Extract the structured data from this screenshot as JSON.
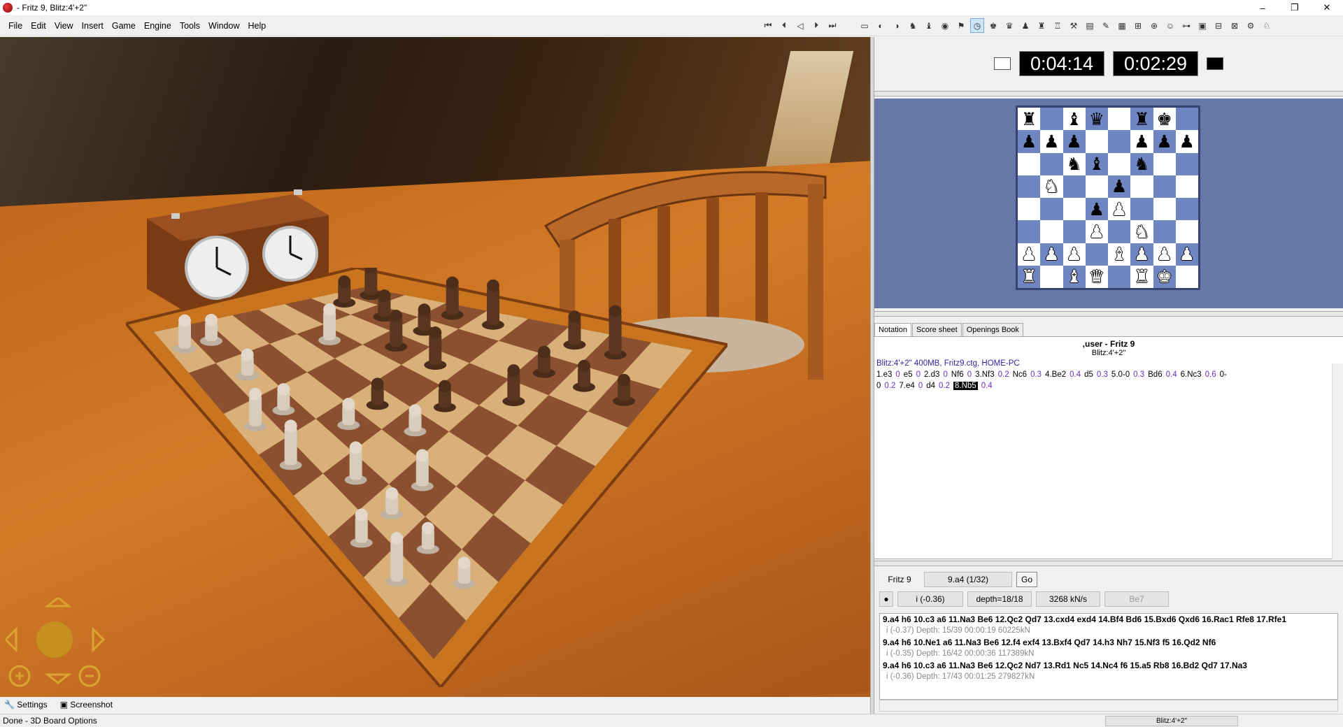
{
  "window": {
    "title": " - Fritz 9, Blitz:4'+2\"",
    "minimize": "–",
    "maximize": "❐",
    "close": "✕"
  },
  "menu": [
    "File",
    "Edit",
    "View",
    "Insert",
    "Game",
    "Engine",
    "Tools",
    "Window",
    "Help"
  ],
  "toolbar": {
    "nav_icons": [
      "first-move-icon",
      "prev-move-icon",
      "take-back-icon",
      "next-move-icon",
      "last-move-icon"
    ],
    "nav_glyphs": [
      "⏮",
      "⏴",
      "◁",
      "⏵",
      "⏭"
    ],
    "tool_icons": [
      "new-game-icon",
      "engine-icon",
      "hint-icon",
      "analysis-icon",
      "piece-icon",
      "globe-icon",
      "flag-icon",
      "clock-icon",
      "king-icon",
      "piece-red-icon",
      "pawn-icon",
      "trophy-icon",
      "fritz-icon",
      "tools-icon",
      "book-icon",
      "pen-icon",
      "board-icon",
      "table-icon",
      "database-icon",
      "people-icon",
      "link-icon",
      "save-icon",
      "layout-icon",
      "grid-icon",
      "gear-icon",
      "piece-set-icon"
    ],
    "tool_glyphs": [
      "▭",
      "◐",
      "◑",
      "♞",
      "♝",
      "◉",
      "⚑",
      "◷",
      "♚",
      "♛",
      "♟",
      "♜",
      "♖",
      "⚒",
      "▤",
      "✎",
      "▦",
      "⊞",
      "⊕",
      "☺",
      "⊶",
      "▣",
      "⊟",
      "⊠",
      "⚙",
      "♘"
    ]
  },
  "clock": {
    "white_time": "0:04:14",
    "black_time": "0:02:29",
    "white_color": "#ffffff",
    "black_color": "#000000"
  },
  "mini_board": {
    "rows": [
      [
        "r",
        "",
        "b",
        "q",
        "",
        "r",
        "k",
        ""
      ],
      [
        "p",
        "p",
        "p",
        "",
        "",
        "p",
        "p",
        "p"
      ],
      [
        "",
        "",
        "n",
        "b",
        "",
        "n",
        "",
        ""
      ],
      [
        "",
        "N",
        "",
        "",
        "p",
        "",
        "",
        ""
      ],
      [
        "",
        "",
        "",
        "p",
        "P",
        "",
        "",
        ""
      ],
      [
        "",
        "",
        "",
        "P",
        "",
        "N",
        "",
        ""
      ],
      [
        "P",
        "P",
        "P",
        "",
        "B",
        "P",
        "P",
        "P"
      ],
      [
        "R",
        "",
        "B",
        "Q",
        "",
        "R",
        "K",
        ""
      ]
    ]
  },
  "tabs": [
    "Notation",
    "Score sheet",
    "Openings Book"
  ],
  "notation": {
    "players": ",user - Fritz 9",
    "event": "Blitz:4'+2\"",
    "info": "Blitz:4'+2\"  400MB, Fritz9.ctg, HOME-PC",
    "moves": [
      {
        "m": "1.e3",
        "e": "0"
      },
      {
        "m": "e5",
        "e": "0"
      },
      {
        "m": "2.d3",
        "e": "0"
      },
      {
        "m": "Nf6",
        "e": "0"
      },
      {
        "m": "3.Nf3",
        "e": "0.2"
      },
      {
        "m": "Nc6",
        "e": "0.3"
      },
      {
        "m": "4.Be2",
        "e": "0.4"
      },
      {
        "m": "d5",
        "e": "0.3"
      },
      {
        "m": "5.0-0",
        "e": "0.3"
      },
      {
        "m": "Bd6",
        "e": "0.4"
      },
      {
        "m": "6.Nc3",
        "e": "0.6"
      },
      {
        "m": "0-0",
        "e": "0.2"
      },
      {
        "m": "7.e4",
        "e": "0"
      },
      {
        "m": "d4",
        "e": "0.2"
      },
      {
        "m": "8.Nb5",
        "e": "0.4",
        "current": true
      }
    ]
  },
  "engine": {
    "name": "Fritz 9",
    "current_move": "9.a4 (1/32)",
    "go": "Go",
    "eval": "i  (-0.36)",
    "depth": "depth=18/18",
    "speed": "3268 kN/s",
    "best": "Be7",
    "lines": [
      {
        "pv": "9.a4 h6 10.c3 a6 11.Na3 Be6 12.Qc2 Qd7 13.cxd4 exd4 14.Bf4 Bd6 15.Bxd6 Qxd6 16.Rac1 Rfe8 17.Rfe1",
        "info": "i  (-0.37)  Depth: 15/39  00:00:19  60225kN"
      },
      {
        "pv": "9.a4 h6 10.Ne1 a6 11.Na3 Be6 12.f4 exf4 13.Bxf4 Qd7 14.h3 Nh7 15.Nf3 f5 16.Qd2 Nf6",
        "info": "i  (-0.35)  Depth: 16/42  00:00:36  117389kN"
      },
      {
        "pv": "9.a4 h6 10.c3 a6 11.Na3 Be6 12.Qc2 Nd7 13.Rd1 Nc5 14.Nc4 f6 15.a5 Rb8 16.Bd2 Qd7 17.Na3",
        "info": "i  (-0.36)  Depth: 17/43  00:01:25  279827kN"
      }
    ]
  },
  "bottom": {
    "settings": "Settings",
    "screenshot": "Screenshot"
  },
  "status": {
    "text": "Done - 3D Board Options",
    "right": "Blitz:4'+2\""
  },
  "colors": {
    "board_panel_bg": "#6677a8",
    "board_dark": "#6f86c3",
    "eval_color": "#6a2fc0",
    "info_color": "#3a1ca0"
  }
}
